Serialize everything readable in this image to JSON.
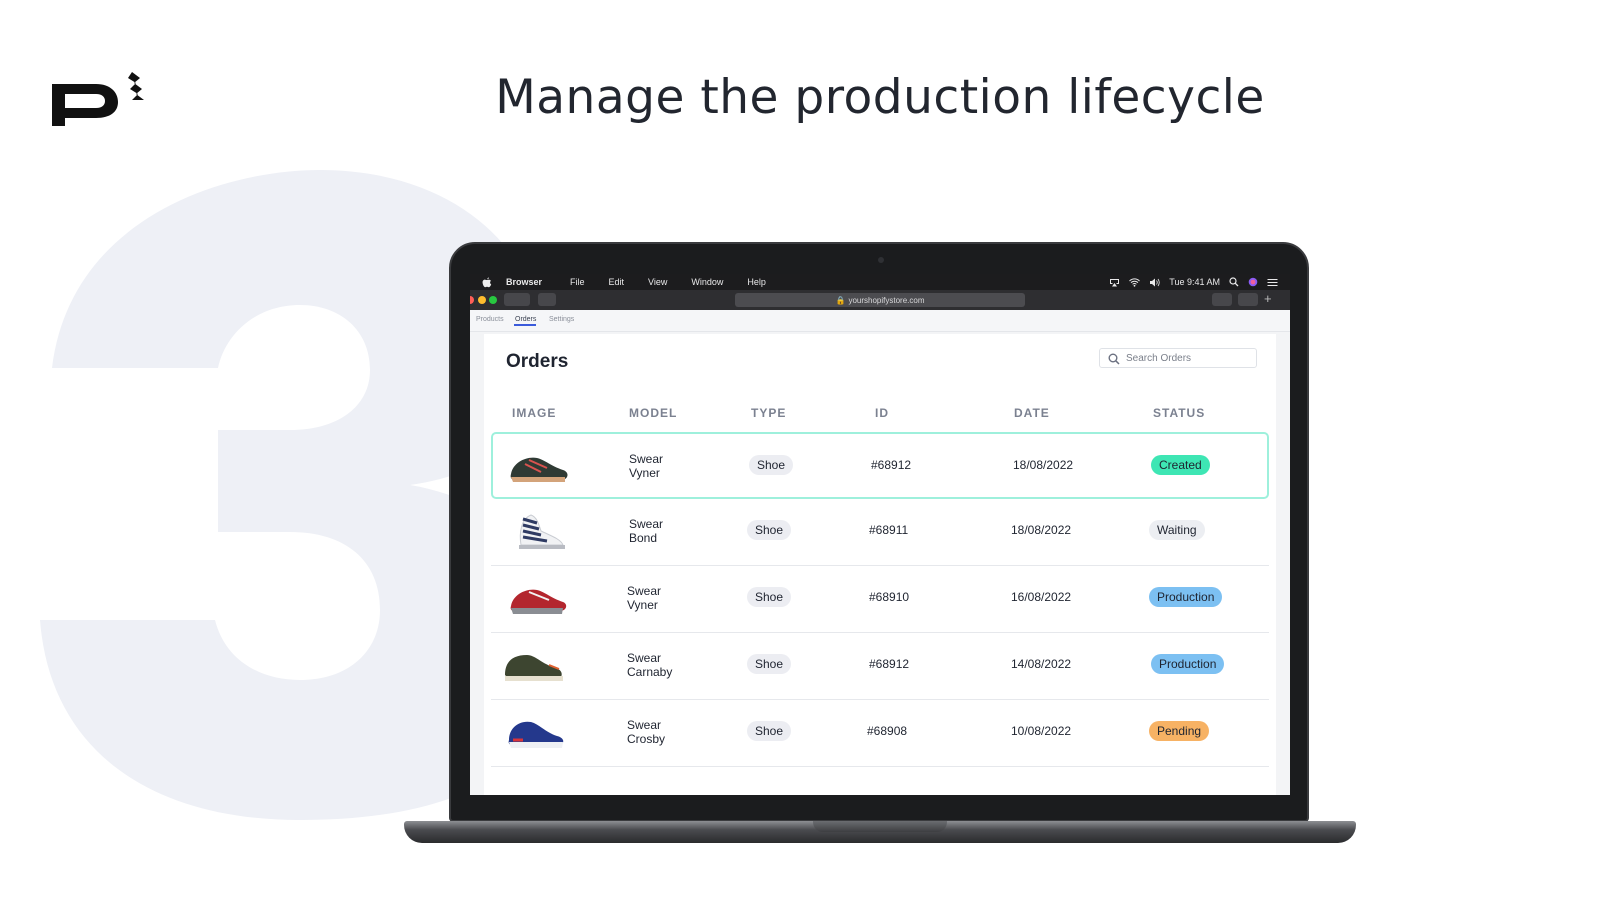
{
  "headline": "Manage the production lifecycle",
  "brand": {
    "logo_icon": "p-logo-icon"
  },
  "menubar": {
    "app": "Browser",
    "menus": [
      "File",
      "Edit",
      "View",
      "Window",
      "Help"
    ],
    "clock": "Tue 9:41 AM"
  },
  "browser": {
    "url": "yourshopifystore.com"
  },
  "app_tabs": [
    "Products",
    "Orders",
    "Settings"
  ],
  "orders": {
    "title": "Orders",
    "search_placeholder": "Search Orders",
    "columns": [
      "IMAGE",
      "MODEL",
      "TYPE",
      "ID",
      "DATE",
      "STATUS"
    ],
    "rows": [
      {
        "model_line1": "Swear",
        "model_line2": "Vyner",
        "type": "Shoe",
        "id": "#68912",
        "date": "18/08/2022",
        "status": "Created",
        "status_color": "#3ee6b4"
      },
      {
        "model_line1": "Swear",
        "model_line2": "Bond",
        "type": "Shoe",
        "id": "#68911",
        "date": "18/08/2022",
        "status": "Waiting",
        "status_color": "#eceef2"
      },
      {
        "model_line1": "Swear",
        "model_line2": "Vyner",
        "type": "Shoe",
        "id": "#68910",
        "date": "16/08/2022",
        "status": "Production",
        "status_color": "#7cc0f2"
      },
      {
        "model_line1": "Swear",
        "model_line2": "Carnaby",
        "type": "Shoe",
        "id": "#68912",
        "date": "14/08/2022",
        "status": "Production",
        "status_color": "#7cc0f2"
      },
      {
        "model_line1": "Swear",
        "model_line2": "Crosby",
        "type": "Shoe",
        "id": "#68908",
        "date": "10/08/2022",
        "status": "Pending",
        "status_color": "#f7b264"
      }
    ]
  },
  "colors": {
    "accent_selected_border": "#9ef0dc",
    "background_numeral": "#eef0f6"
  }
}
